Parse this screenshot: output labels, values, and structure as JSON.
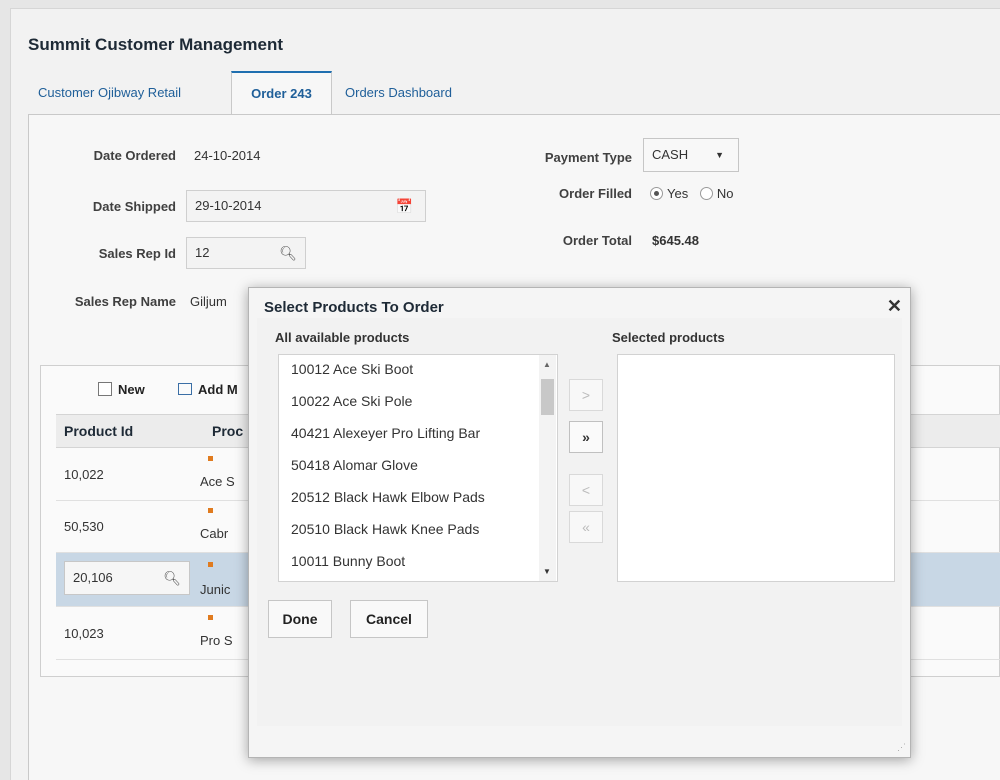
{
  "app": {
    "title": "Summit Customer Management",
    "tabs": [
      "Customer Ojibway Retail",
      "Order 243",
      "Orders Dashboard"
    ]
  },
  "form": {
    "date_ordered_label": "Date Ordered",
    "date_ordered": "24-10-2014",
    "date_shipped_label": "Date Shipped",
    "date_shipped": "29-10-2014",
    "sales_rep_id_label": "Sales Rep Id",
    "sales_rep_id": "12",
    "sales_rep_name_label": "Sales Rep Name",
    "sales_rep_name": "Giljum",
    "payment_type_label": "Payment Type",
    "payment_type": "CASH",
    "order_filled_label": "Order Filled",
    "order_filled_yes": "Yes",
    "order_filled_no": "No",
    "order_total_label": "Order Total",
    "order_total": "$645.48"
  },
  "toolbar": {
    "new_label": "New",
    "add_label": "Add M"
  },
  "table": {
    "headers": [
      "Product Id",
      "Proc"
    ],
    "rows": [
      {
        "id": "10,022",
        "name": "Ace S"
      },
      {
        "id": "50,530",
        "name": "Cabr"
      },
      {
        "id": "20,106",
        "name": "Junic"
      },
      {
        "id": "10,023",
        "name": "Pro S"
      }
    ]
  },
  "dialog": {
    "title": "Select Products To Order",
    "available_label": "All available products",
    "selected_label": "Selected products",
    "available": [
      "10012 Ace Ski Boot",
      "10022 Ace Ski Pole",
      "40421 Alexeyer Pro Lifting Bar",
      "50418 Alomar Glove",
      "20512 Black Hawk Elbow Pads",
      "20510 Black Hawk Knee Pads",
      "10011 Bunny Boot"
    ],
    "move_one": ">",
    "move_all": "»",
    "remove_one": "<",
    "remove_all": "«",
    "done_label": "Done",
    "cancel_label": "Cancel"
  }
}
